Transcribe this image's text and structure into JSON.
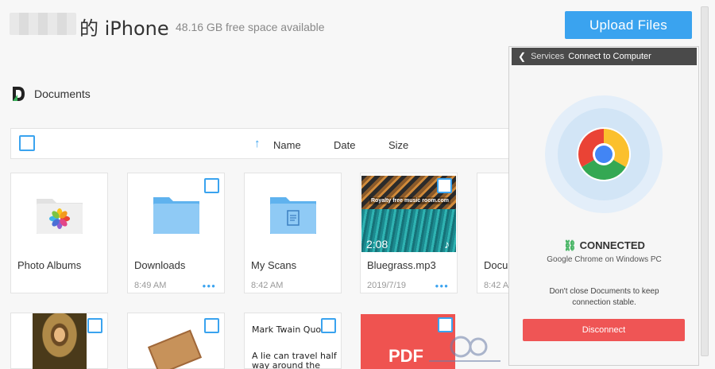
{
  "header": {
    "device_title": "的 iPhone",
    "free_space": "48.16 GB free space available",
    "upload_label": "Upload Files"
  },
  "breadcrumb": {
    "label": "Documents"
  },
  "toolbar": {
    "col_name": "Name",
    "col_date": "Date",
    "col_size": "Size"
  },
  "files": [
    {
      "name": "Photo Albums",
      "meta": "",
      "type": "photos-folder"
    },
    {
      "name": "Downloads",
      "meta": "8:49 AM",
      "type": "folder"
    },
    {
      "name": "My Scans",
      "meta": "8:42 AM",
      "type": "scans-folder"
    },
    {
      "name": "Bluegrass.mp3",
      "meta": "2019/7/19",
      "type": "audio",
      "thumb_title": "Royalty free music room.com",
      "duration": "2:08"
    },
    {
      "name": "Docum",
      "meta": "8:42 AM",
      "type": "folder"
    },
    {
      "name": "",
      "meta": "",
      "type": "image-monalisa"
    },
    {
      "name": "",
      "meta": "",
      "type": "image-package"
    },
    {
      "name": "",
      "meta": "",
      "type": "text-note",
      "line1": "Mark Twain Quote",
      "line2": "A lie can travel half",
      "line3": "way around the world"
    },
    {
      "name": "",
      "meta": "",
      "type": "pdf",
      "badge": "PDF"
    }
  ],
  "panel": {
    "back_label": "Services",
    "title": "Connect to Computer",
    "status": "CONNECTED",
    "status_sub": "Google Chrome on Windows PC",
    "warning": "Don't close Documents to keep connection stable.",
    "disconnect_label": "Disconnect"
  },
  "colors": {
    "accent": "#3aa3ef",
    "danger": "#ef5555",
    "connected": "#3bb05a"
  }
}
